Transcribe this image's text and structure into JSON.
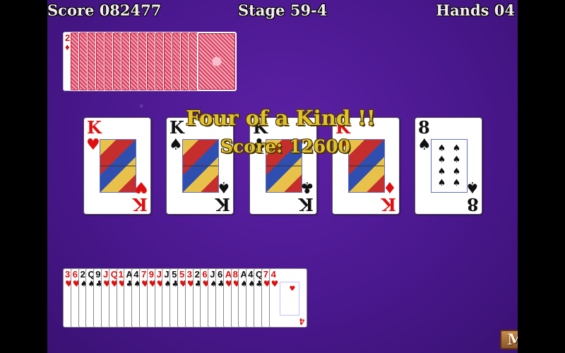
{
  "hud": {
    "score": "Score 082477",
    "stage": "Stage 59-4",
    "hands": "Hands 04"
  },
  "deck": {
    "face_up_rank": "2",
    "face_up_suit": "♦",
    "back_count": 16
  },
  "announcement": {
    "hand_name": "Four of a Kind !!",
    "score": "Score: 12600"
  },
  "hand_cards": [
    {
      "rank": "K",
      "suit": "♥",
      "color": "red"
    },
    {
      "rank": "K",
      "suit": "♠",
      "color": "black"
    },
    {
      "rank": "K",
      "suit": "♣",
      "color": "black"
    },
    {
      "rank": "K",
      "suit": "♦",
      "color": "red"
    },
    {
      "rank": "8",
      "suit": "♠",
      "color": "black"
    }
  ],
  "remaining_cards": [
    {
      "rank": "3",
      "suit": "♥",
      "color": "red"
    },
    {
      "rank": "6",
      "suit": "♥",
      "color": "red"
    },
    {
      "rank": "2",
      "suit": "♠",
      "color": "black"
    },
    {
      "rank": "Q",
      "suit": "♠",
      "color": "black"
    },
    {
      "rank": "9",
      "suit": "♣",
      "color": "black"
    },
    {
      "rank": "J",
      "suit": "♥",
      "color": "red"
    },
    {
      "rank": "Q",
      "suit": "♥",
      "color": "red"
    },
    {
      "rank": "10",
      "suit": "♥",
      "color": "red"
    },
    {
      "rank": "A",
      "suit": "♣",
      "color": "black"
    },
    {
      "rank": "4",
      "suit": "♠",
      "color": "black"
    },
    {
      "rank": "7",
      "suit": "♥",
      "color": "red"
    },
    {
      "rank": "9",
      "suit": "♥",
      "color": "red"
    },
    {
      "rank": "J",
      "suit": "♥",
      "color": "red"
    },
    {
      "rank": "J",
      "suit": "♠",
      "color": "black"
    },
    {
      "rank": "5",
      "suit": "♣",
      "color": "black"
    },
    {
      "rank": "5",
      "suit": "♥",
      "color": "red"
    },
    {
      "rank": "3",
      "suit": "♥",
      "color": "red"
    },
    {
      "rank": "2",
      "suit": "♣",
      "color": "black"
    },
    {
      "rank": "6",
      "suit": "♥",
      "color": "red"
    },
    {
      "rank": "J",
      "suit": "♠",
      "color": "black"
    },
    {
      "rank": "6",
      "suit": "♣",
      "color": "black"
    },
    {
      "rank": "A",
      "suit": "♥",
      "color": "red"
    },
    {
      "rank": "8",
      "suit": "♥",
      "color": "red"
    },
    {
      "rank": "A",
      "suit": "♠",
      "color": "black"
    },
    {
      "rank": "4",
      "suit": "♠",
      "color": "black"
    },
    {
      "rank": "Q",
      "suit": "♣",
      "color": "black"
    },
    {
      "rank": "7",
      "suit": "♥",
      "color": "red"
    },
    {
      "rank": "4",
      "suit": "♥",
      "color": "red"
    }
  ],
  "menu_label": "Menu",
  "colors": {
    "felt": "#4a188e",
    "announce": "#e2c32c",
    "card_red": "#e00f0f"
  }
}
